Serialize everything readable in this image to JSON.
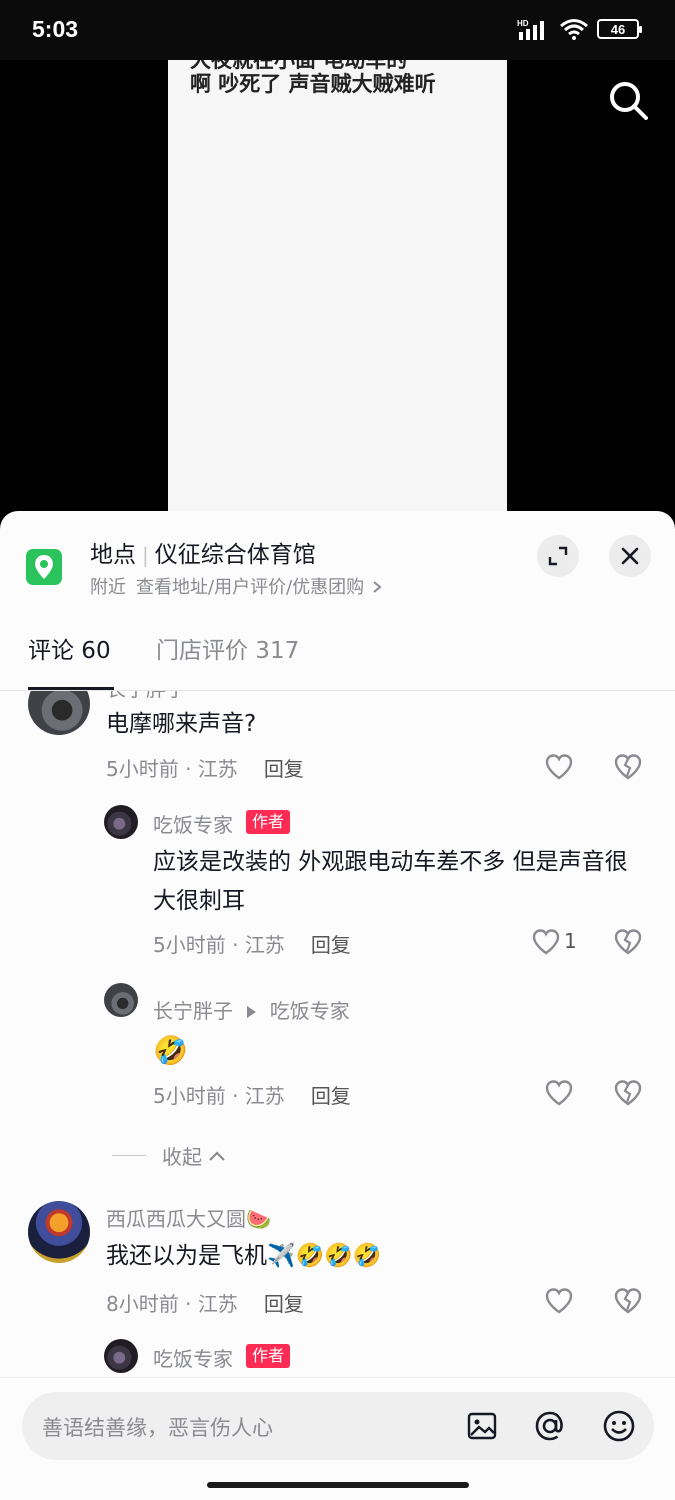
{
  "status_bar": {
    "time": "5:03",
    "network": "HD",
    "battery": "46"
  },
  "video": {
    "caption_line_cut": "大夜就在小面 电动车的",
    "caption_line": "啊 吵死了 声音贼大贼难听"
  },
  "location": {
    "label": "地点",
    "place": "仪征综合体育馆",
    "subtitle_prefix": "附近",
    "subtitle_link": "查看地址/用户评价/优惠团购",
    "icon": "map-pin-icon",
    "accent": "#2bc35b"
  },
  "tabs": [
    {
      "label": "评论 60"
    },
    {
      "label": "门店评价 317"
    }
  ],
  "comments": [
    {
      "user": "长宁胖子",
      "text": "电摩哪来声音?",
      "time": "5小时前",
      "region": "江苏",
      "reply_label": "回复",
      "likes": ""
    },
    {
      "user": "吃饭专家",
      "tag": "作者",
      "text": "应该是改装的 外观跟电动车差不多 但是声音很大很刺耳",
      "time": "5小时前",
      "region": "江苏",
      "reply_label": "回复",
      "likes": "1"
    },
    {
      "user": "长宁胖子",
      "reply_to": "吃饭专家",
      "text": "🤣",
      "time": "5小时前",
      "region": "江苏",
      "reply_label": "回复",
      "likes": ""
    },
    {
      "collapse_label": "收起"
    },
    {
      "user": "西瓜西瓜大又圆🍉",
      "text": "我还以为是飞机✈️🤣🤣🤣",
      "time": "8小时前",
      "region": "江苏",
      "reply_label": "回复",
      "likes": ""
    },
    {
      "user": "吃饭专家",
      "tag": "作者"
    }
  ],
  "input": {
    "placeholder": "善语结善缘，恶言伤人心"
  },
  "colors": {
    "author_tag": "#fe2c55",
    "text_primary": "#161823",
    "text_secondary": "#8a8b91"
  }
}
